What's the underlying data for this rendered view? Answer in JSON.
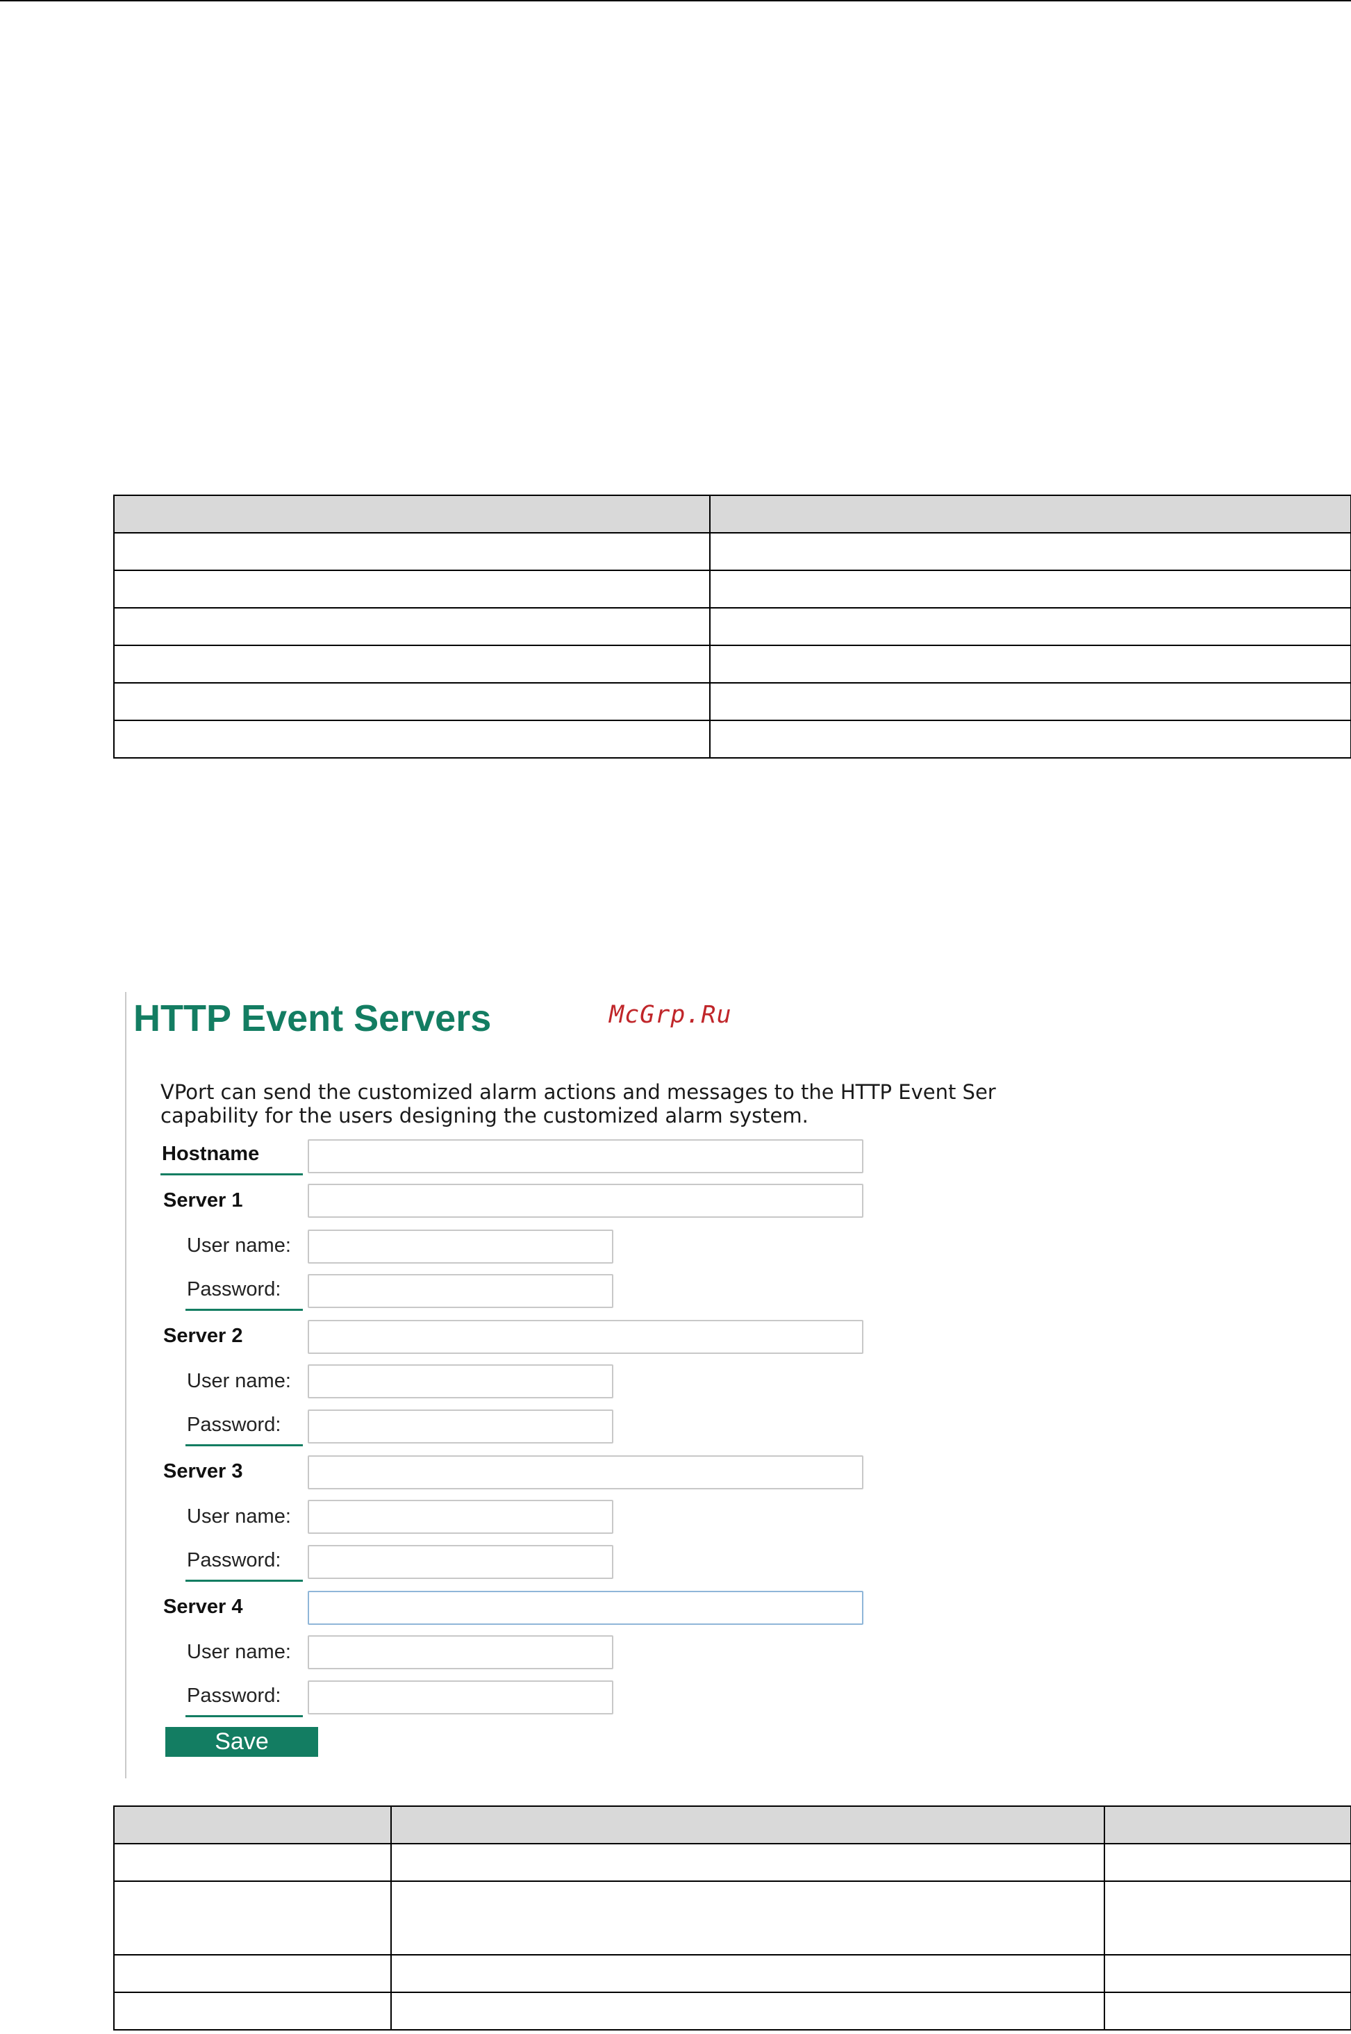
{
  "ui": {
    "title": "HTTP Event Servers",
    "watermark": "McGrp.Ru",
    "description_lines": [
      "VPort can send the customized alarm actions and messages to the HTTP Event Ser",
      "capability for the users designing the customized alarm system."
    ],
    "hostname_label": "Hostname",
    "username_label": "User name:",
    "password_label": "Password:",
    "servers": [
      {
        "label": "Server 1"
      },
      {
        "label": "Server 2"
      },
      {
        "label": "Server 3"
      },
      {
        "label": "Server 4"
      }
    ],
    "save_label": "Save",
    "colors": {
      "accent": "#137d62",
      "watermark": "#c0262a"
    }
  }
}
